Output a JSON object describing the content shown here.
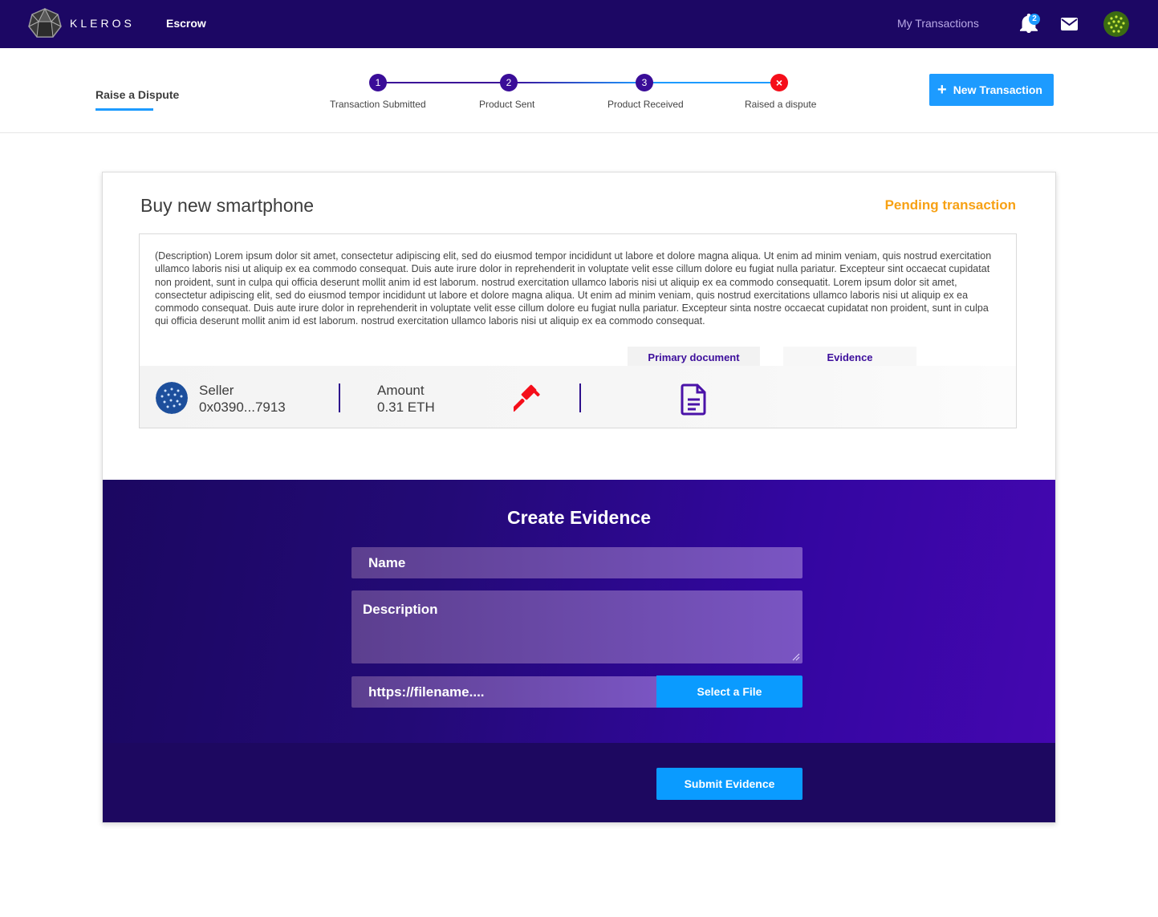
{
  "nav": {
    "brand": "KLEROS",
    "escrow": "Escrow",
    "my_transactions": "My Transactions",
    "notification_count": "2"
  },
  "subheader": {
    "active_tab": "Raise a Dispute",
    "steps": [
      {
        "number": "1",
        "label": "Transaction Submitted",
        "status": "done"
      },
      {
        "number": "2",
        "label": "Product Sent",
        "status": "done"
      },
      {
        "number": "3",
        "label": "Product Received",
        "status": "done"
      },
      {
        "number": "×",
        "label": "Raised a dispute",
        "status": "error"
      }
    ],
    "new_transaction": "New Transaction"
  },
  "transaction": {
    "title": "Buy new smartphone",
    "status": "Pending transaction",
    "description": "(Description) Lorem ipsum dolor sit amet, consectetur adipiscing elit, sed do eiusmod tempor incididunt ut labore et dolore magna aliqua. Ut enim ad minim veniam, quis nostrud exercitation ullamco laboris nisi ut aliquip ex ea commodo consequat. Duis aute irure dolor in reprehenderit in voluptate velit esse cillum dolore eu fugiat nulla pariatur. Excepteur sint occaecat cupidatat non proident, sunt in culpa qui officia deserunt mollit anim id est laborum. nostrud exercitation ullamco laboris nisi ut aliquip ex ea commodo consequatit. Lorem ipsum dolor sit amet, consectetur adipiscing elit, sed do eiusmod tempor incididunt ut labore et dolore magna aliqua. Ut enim ad minim veniam, quis nostrud exercitations ullamco laboris nisi ut aliquip ex ea commodo consequat. Duis aute irure dolor in reprehenderit in voluptate velit esse cillum dolore eu fugiat nulla pariatur. Excepteur sinta nostre occaecat cupidatat non proident, sunt in culpa qui officia deserunt mollit anim id est laborum. nostrud exercitation ullamco laboris nisi ut aliquip ex ea commodo consequat.",
    "tabs": {
      "primary": "Primary document",
      "evidence": "Evidence"
    },
    "seller_label": "Seller",
    "seller_value": "0x0390...7913",
    "amount_label": "Amount",
    "amount_value": "0.31 ETH"
  },
  "evidence_form": {
    "title": "Create Evidence",
    "name_placeholder": "Name",
    "description_placeholder": "Description",
    "file_placeholder": "https://filename....",
    "select_file": "Select a File",
    "submit": "Submit Evidence"
  },
  "colors": {
    "nav_bg": "#1c0764",
    "accent": "#1d9bff",
    "step": "#3a0d98",
    "error": "#f50e1a",
    "pending": "#f7a114"
  },
  "icons": [
    "kleros-logo-icon",
    "bell-icon",
    "mail-icon",
    "avatar",
    "plus-icon",
    "gavel-icon",
    "document-icon"
  ]
}
